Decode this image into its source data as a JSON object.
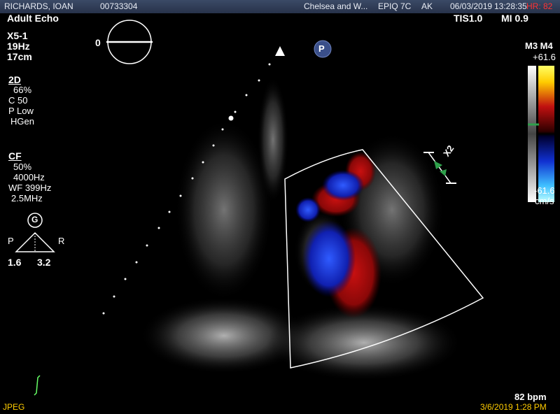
{
  "header": {
    "patient_name": "RICHARDS, IOAN",
    "patient_id": "00733304",
    "institution": "Chelsea and W...",
    "system": "EPIQ 7C",
    "operator": "AK",
    "date": "06/03/2019",
    "time": "13:28:35",
    "hr": "HR: 82"
  },
  "exam": {
    "preset": "Adult Echo",
    "probe": "X5-1",
    "frame_rate": "19Hz",
    "depth": "17cm",
    "tis": "TIS1.0",
    "mi": "MI 0.9"
  },
  "mode_2d": {
    "title": "2D",
    "gain": "66%",
    "compress": "C 50",
    "power": "P Low",
    "freq": "HGen"
  },
  "mode_cf": {
    "title": "CF",
    "gain": "50%",
    "prf": "4000Hz",
    "wall_filter": "WF 399Hz",
    "freq": "2.5MHz"
  },
  "orientation": {
    "badge": "G",
    "left": "P",
    "right": "R",
    "left_value": "1.6",
    "right_value": "3.2",
    "angle": "0"
  },
  "color_map": {
    "title": "M3 M4",
    "max": "+61.6",
    "min": "-61.6",
    "unit": "cm/s"
  },
  "zoom": {
    "label": "X2"
  },
  "probe_marker": "P",
  "footer": {
    "bpm": "82 bpm",
    "format": "JPEG",
    "timestamp": "3/6/2019 1:28 PM"
  },
  "colors": {
    "accent": "#ffcc00",
    "topbar": "#2f3c57",
    "hr": "#ff3333",
    "ecg": "#66ff66"
  }
}
